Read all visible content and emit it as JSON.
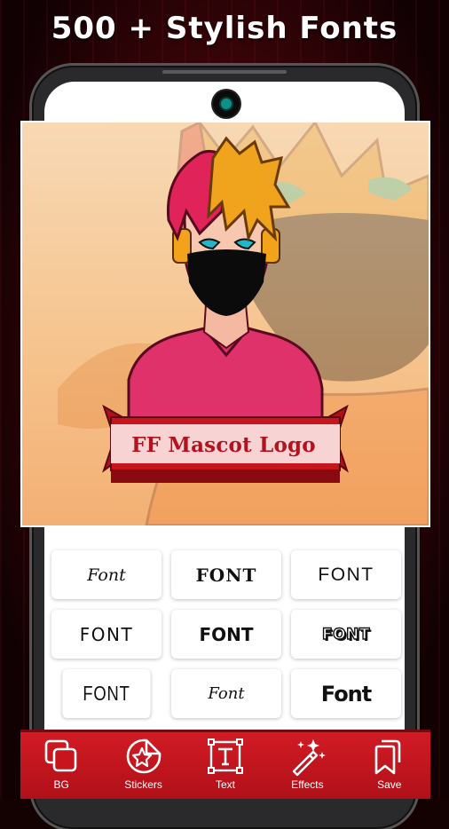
{
  "headline": "500 + Stylish Fonts",
  "canvas": {
    "logo_text": "FF Mascot Logo"
  },
  "font_samples": [
    {
      "label": "Font",
      "style": "script-italic"
    },
    {
      "label": "FONT",
      "style": "serif-bold"
    },
    {
      "label": "FONT",
      "style": "sans-regular"
    },
    {
      "label": "FONT",
      "style": "sans-regular"
    },
    {
      "label": "FONT",
      "style": "heavy-bold"
    },
    {
      "label": "FONT",
      "style": "outline-3d"
    },
    {
      "label": "FONT",
      "style": "condensed"
    },
    {
      "label": "Font",
      "style": "script-italic"
    },
    {
      "label": "Font",
      "style": "rounded-heavy"
    }
  ],
  "toolbar": {
    "items": [
      {
        "label": "BG",
        "icon": "layers-icon"
      },
      {
        "label": "Stickers",
        "icon": "sticker-star-icon"
      },
      {
        "label": "Text",
        "icon": "text-box-icon"
      },
      {
        "label": "Effects",
        "icon": "magic-wand-icon"
      },
      {
        "label": "Save",
        "icon": "save-copy-icon"
      }
    ]
  },
  "colors": {
    "accent": "#c8141d",
    "logo_text": "#b3121f",
    "background": "#140203"
  }
}
